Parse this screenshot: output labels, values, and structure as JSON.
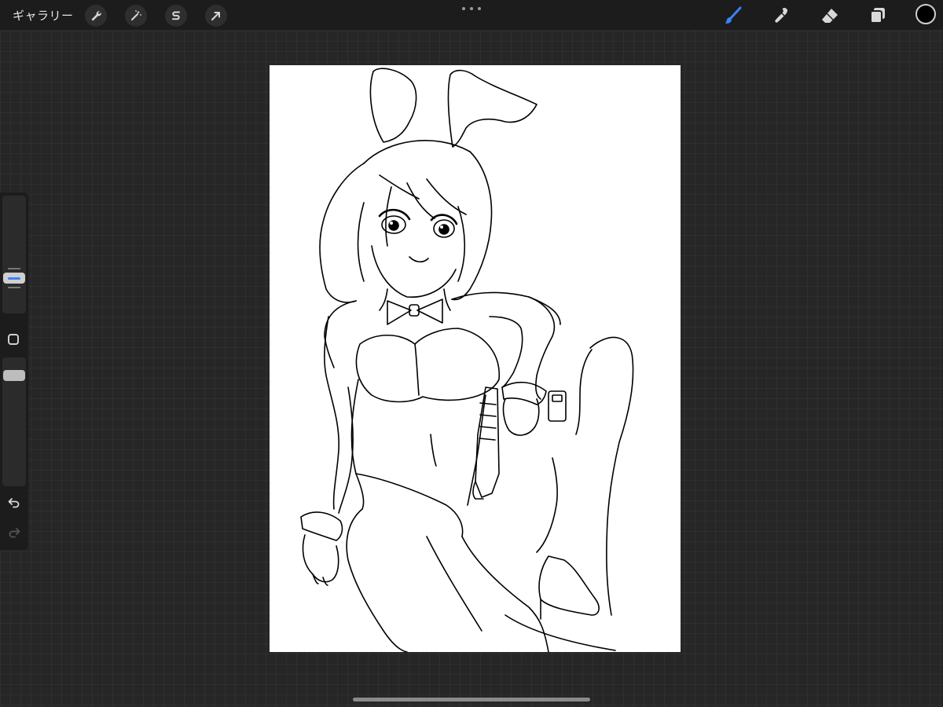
{
  "topbar": {
    "gallery_label": "ギャラリー",
    "left_tools": [
      "wrench-icon",
      "magic-wand-icon",
      "selection-s-icon",
      "transform-arrow-icon"
    ],
    "right_tools": [
      "brush-icon",
      "smudge-icon",
      "eraser-icon",
      "layers-icon"
    ],
    "active_tool": "brush-icon",
    "active_color": "#000000",
    "accent_color": "#3b82f6"
  },
  "sidebar": {
    "brush_size_icon": "brush-size-slider",
    "modify_icon": "modify-square-icon",
    "opacity_icon": "opacity-slider",
    "undo_icon": "undo-icon",
    "redo_icon": "redo-icon"
  },
  "canvas": {
    "background": "#ffffff",
    "content": "line-art-illustration"
  }
}
